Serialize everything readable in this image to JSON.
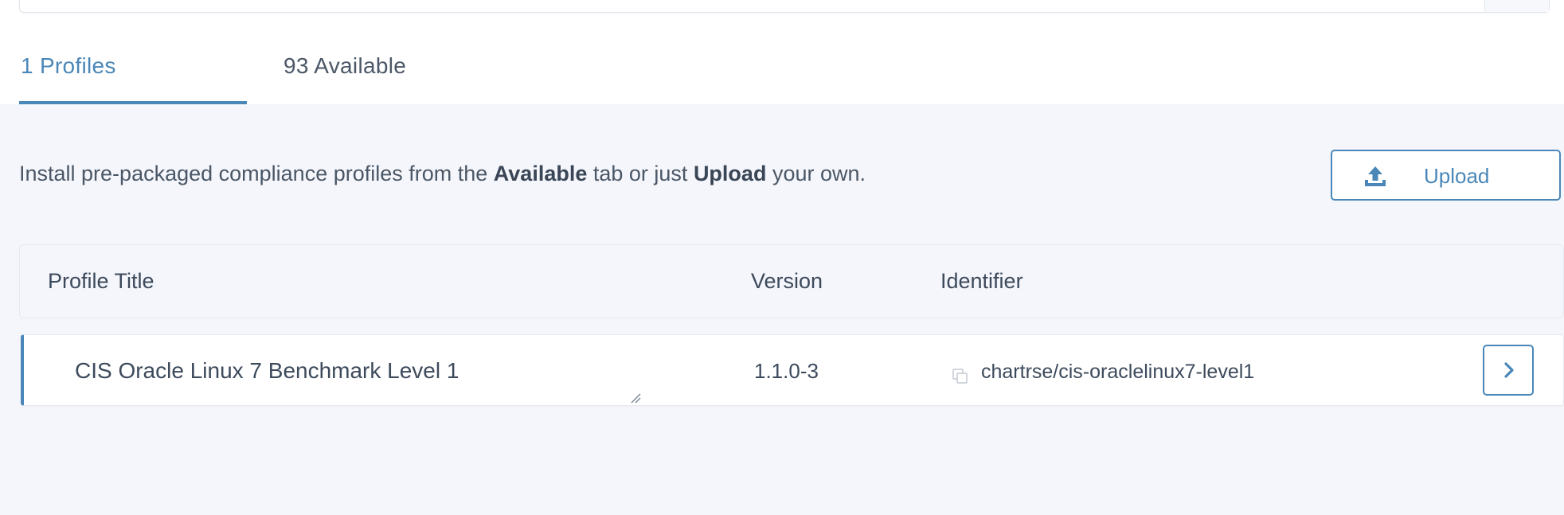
{
  "tabs": {
    "profiles": "1 Profiles",
    "available": "93 Available"
  },
  "intro": {
    "prefix": "Install pre-packaged compliance profiles from the ",
    "available_word": "Available",
    "middle": " tab or just ",
    "upload_word": "Upload",
    "suffix": " your own."
  },
  "upload_button": {
    "label": "Upload",
    "icon": "upload-icon"
  },
  "table": {
    "headers": {
      "title": "Profile Title",
      "version": "Version",
      "identifier": "Identifier"
    },
    "rows": [
      {
        "title": "CIS Oracle Linux 7 Benchmark Level 1",
        "version": "1.1.0-3",
        "identifier": "chartrse/cis-oraclelinux7-level1"
      }
    ]
  },
  "colors": {
    "accent": "#4a87b8",
    "page_background": "#f4f6fb",
    "text": "#3d4a5c"
  }
}
